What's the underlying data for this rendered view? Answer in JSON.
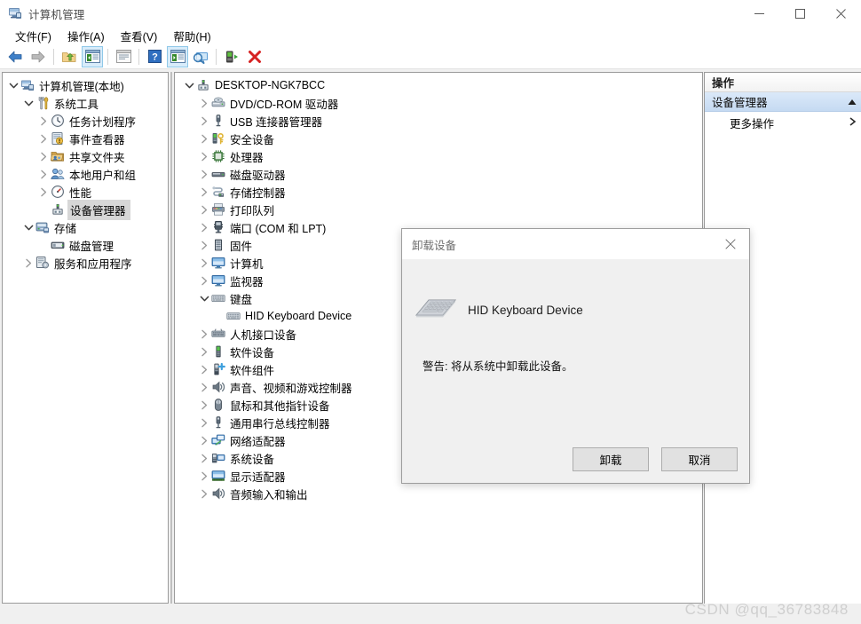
{
  "window": {
    "title": "计算机管理",
    "app_icon": "computer-management-icon",
    "controls": {
      "minimize": "最小化",
      "maximize": "最大化",
      "close": "关闭"
    }
  },
  "menubar": {
    "items": [
      {
        "label": "文件(F)",
        "name": "menu-file"
      },
      {
        "label": "操作(A)",
        "name": "menu-action"
      },
      {
        "label": "查看(V)",
        "name": "menu-view"
      },
      {
        "label": "帮助(H)",
        "name": "menu-help"
      }
    ]
  },
  "toolbar": {
    "buttons": [
      {
        "icon": "back-arrow-icon",
        "label": "后退"
      },
      {
        "icon": "forward-arrow-icon",
        "label": "前进"
      },
      {
        "icon": "up-folder-icon",
        "label": "向上"
      },
      {
        "icon": "show-tree-icon",
        "label": "显示/隐藏控制台树",
        "active": true
      },
      {
        "icon": "properties-icon",
        "label": "属性"
      },
      {
        "icon": "help-icon",
        "label": "帮助"
      },
      {
        "icon": "show-action-pane-icon",
        "label": "显示/隐藏操作窗格",
        "active": true
      },
      {
        "icon": "scan-hardware-icon",
        "label": "扫描检测硬件改动"
      },
      {
        "icon": "update-driver-icon",
        "label": "更新驱动程序"
      },
      {
        "icon": "uninstall-device-icon",
        "label": "卸载设备"
      }
    ]
  },
  "sidebar": {
    "items": [
      {
        "label": "计算机管理(本地)",
        "icon": "computer-icon",
        "depth": 0,
        "twisty": "expanded-root",
        "selected": false
      },
      {
        "label": "系统工具",
        "icon": "system-tools-icon",
        "depth": 1,
        "twisty": "expanded",
        "selected": false
      },
      {
        "label": "任务计划程序",
        "icon": "task-scheduler-icon",
        "depth": 2,
        "twisty": "collapsed",
        "selected": false
      },
      {
        "label": "事件查看器",
        "icon": "event-viewer-icon",
        "depth": 2,
        "twisty": "collapsed",
        "selected": false
      },
      {
        "label": "共享文件夹",
        "icon": "shared-folders-icon",
        "depth": 2,
        "twisty": "collapsed",
        "selected": false
      },
      {
        "label": "本地用户和组",
        "icon": "local-users-groups-icon",
        "depth": 2,
        "twisty": "collapsed",
        "selected": false
      },
      {
        "label": "性能",
        "icon": "performance-icon",
        "depth": 2,
        "twisty": "collapsed",
        "selected": false
      },
      {
        "label": "设备管理器",
        "icon": "device-manager-icon",
        "depth": 2,
        "twisty": "none",
        "selected": true
      },
      {
        "label": "存储",
        "icon": "storage-icon",
        "depth": 1,
        "twisty": "expanded",
        "selected": false
      },
      {
        "label": "磁盘管理",
        "icon": "disk-management-icon",
        "depth": 2,
        "twisty": "none",
        "selected": false
      },
      {
        "label": "服务和应用程序",
        "icon": "services-apps-icon",
        "depth": 1,
        "twisty": "collapsed",
        "selected": false
      }
    ]
  },
  "device_tree": {
    "items": [
      {
        "label": "DESKTOP-NGK7BCC",
        "icon": "computer-node-icon",
        "depth": 0,
        "twisty": "expanded"
      },
      {
        "label": "DVD/CD-ROM 驱动器",
        "icon": "dvd-drive-icon",
        "depth": 1,
        "twisty": "collapsed"
      },
      {
        "label": "USB 连接器管理器",
        "icon": "usb-icon",
        "depth": 1,
        "twisty": "collapsed"
      },
      {
        "label": "安全设备",
        "icon": "security-device-icon",
        "depth": 1,
        "twisty": "collapsed"
      },
      {
        "label": "处理器",
        "icon": "processor-icon",
        "depth": 1,
        "twisty": "collapsed"
      },
      {
        "label": "磁盘驱动器",
        "icon": "disk-drive-icon",
        "depth": 1,
        "twisty": "collapsed"
      },
      {
        "label": "存储控制器",
        "icon": "storage-controller-icon",
        "depth": 1,
        "twisty": "collapsed"
      },
      {
        "label": "打印队列",
        "icon": "printer-icon",
        "depth": 1,
        "twisty": "collapsed"
      },
      {
        "label": "端口 (COM 和 LPT)",
        "icon": "port-icon",
        "depth": 1,
        "twisty": "collapsed"
      },
      {
        "label": "固件",
        "icon": "firmware-icon",
        "depth": 1,
        "twisty": "collapsed"
      },
      {
        "label": "计算机",
        "icon": "monitor-icon",
        "depth": 1,
        "twisty": "collapsed"
      },
      {
        "label": "监视器",
        "icon": "monitor-icon",
        "depth": 1,
        "twisty": "collapsed"
      },
      {
        "label": "键盘",
        "icon": "keyboard-icon",
        "depth": 1,
        "twisty": "expanded"
      },
      {
        "label": "HID Keyboard Device",
        "icon": "keyboard-icon",
        "depth": 2,
        "twisty": "none"
      },
      {
        "label": "人机接口设备",
        "icon": "hid-icon",
        "depth": 1,
        "twisty": "collapsed"
      },
      {
        "label": "软件设备",
        "icon": "software-device-icon",
        "depth": 1,
        "twisty": "collapsed"
      },
      {
        "label": "软件组件",
        "icon": "software-component-icon",
        "depth": 1,
        "twisty": "collapsed"
      },
      {
        "label": "声音、视频和游戏控制器",
        "icon": "sound-icon",
        "depth": 1,
        "twisty": "collapsed"
      },
      {
        "label": "鼠标和其他指针设备",
        "icon": "mouse-icon",
        "depth": 1,
        "twisty": "collapsed"
      },
      {
        "label": "通用串行总线控制器",
        "icon": "usb-icon",
        "depth": 1,
        "twisty": "collapsed"
      },
      {
        "label": "网络适配器",
        "icon": "network-adapter-icon",
        "depth": 1,
        "twisty": "collapsed"
      },
      {
        "label": "系统设备",
        "icon": "system-device-icon",
        "depth": 1,
        "twisty": "collapsed"
      },
      {
        "label": "显示适配器",
        "icon": "display-adapter-icon",
        "depth": 1,
        "twisty": "collapsed"
      },
      {
        "label": "音频输入和输出",
        "icon": "audio-io-icon",
        "depth": 1,
        "twisty": "collapsed"
      }
    ]
  },
  "actions_pane": {
    "header": "操作",
    "group_title": "设备管理器",
    "group_collapse_icon": "triangle-up-icon",
    "rows": [
      {
        "label": "更多操作",
        "name": "action-more-actions",
        "chevron": "chevron-right-icon"
      }
    ]
  },
  "dialog": {
    "title": "卸载设备",
    "close_icon": "close-icon",
    "device_icon": "keyboard-device-icon",
    "device_name": "HID Keyboard Device",
    "warning": "警告: 将从系统中卸载此设备。",
    "buttons": [
      {
        "label": "卸载",
        "name": "uninstall-button",
        "primary": true
      },
      {
        "label": "取消",
        "name": "cancel-button",
        "primary": false
      }
    ]
  },
  "watermark": "CSDN @qq_36783848",
  "colors": {
    "accent_blue": "#cce8ff",
    "action_group_blue": "#cfe0f5",
    "selection_gray": "#d7d7d7",
    "close_red": "#e81123",
    "border_gray": "#9a9a9a"
  }
}
